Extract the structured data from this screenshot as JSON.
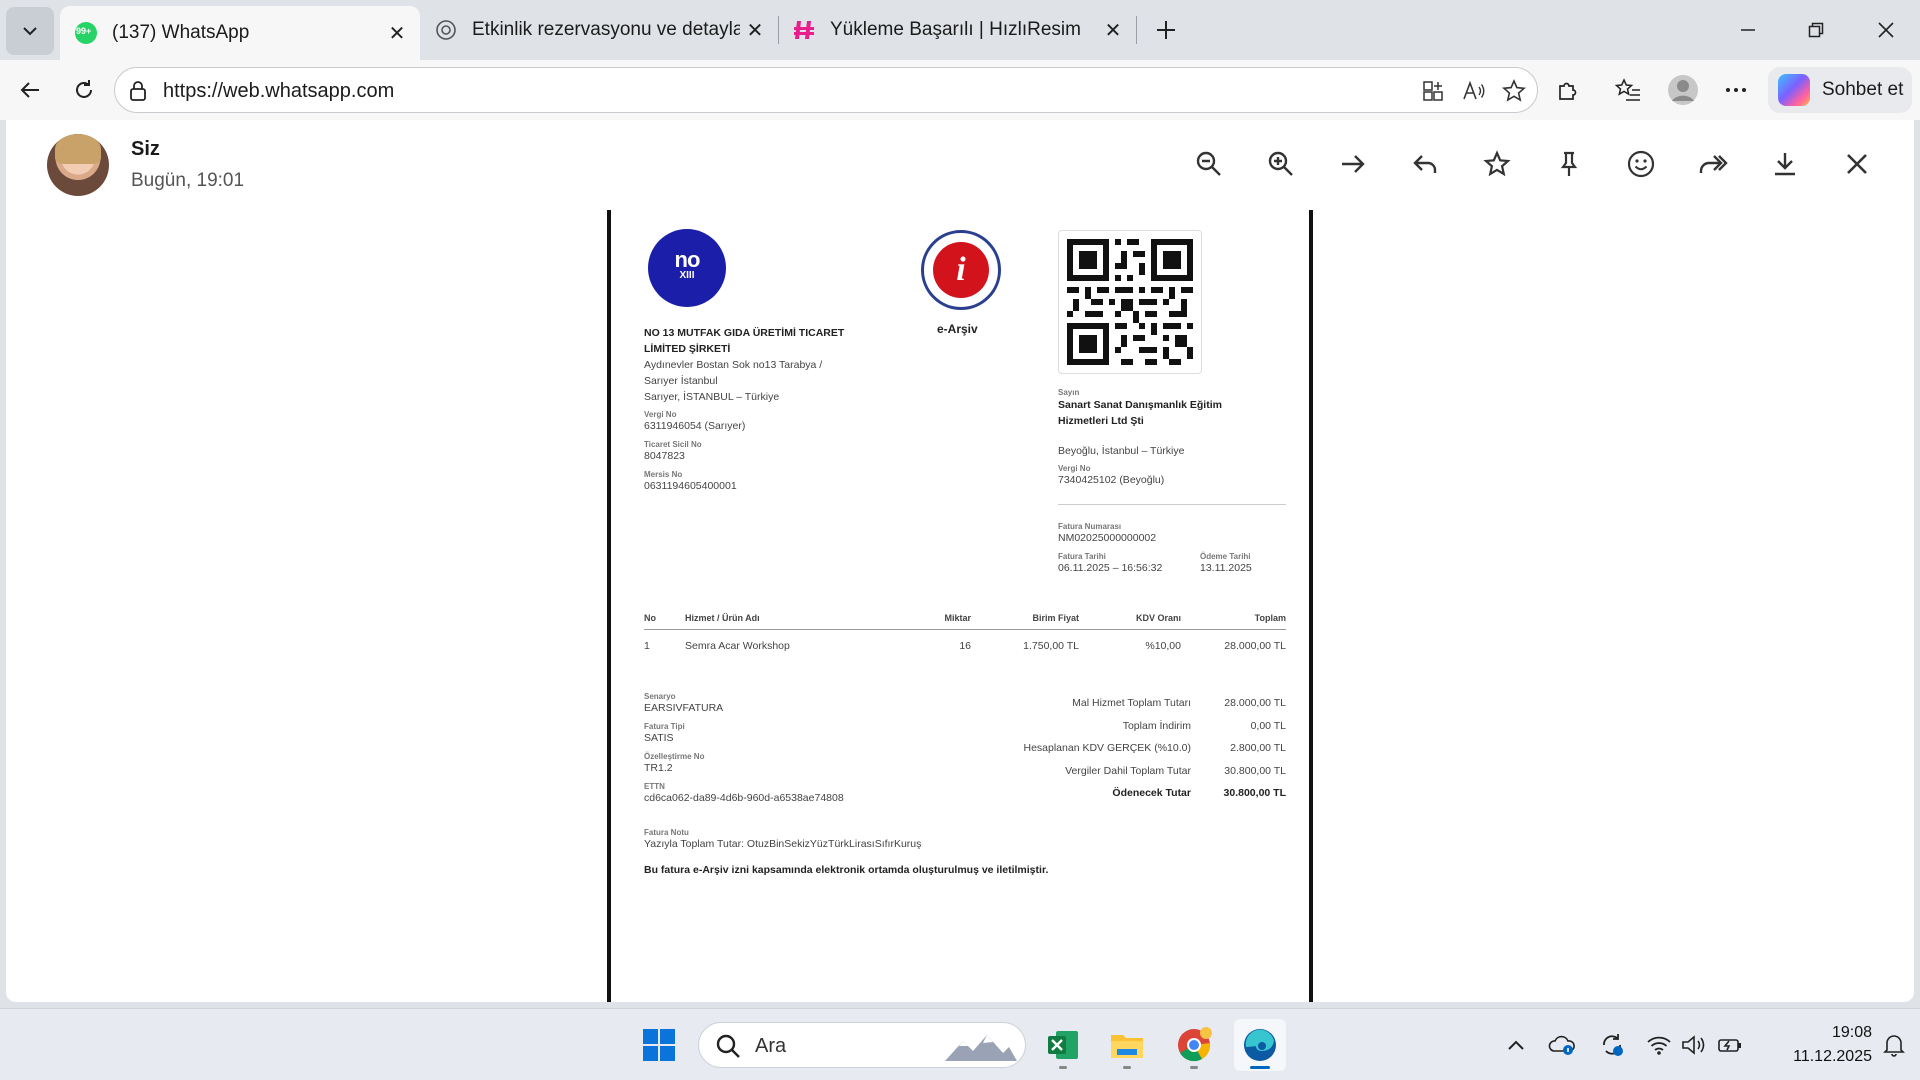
{
  "browser": {
    "tabs": [
      {
        "title": "(137) WhatsApp",
        "badge": "99+",
        "active": true
      },
      {
        "title": "Etkinlik rezervasyonu ve detaylar",
        "active": false
      },
      {
        "title": "Yükleme Başarılı | HızlıResim",
        "active": false
      }
    ],
    "url": "https://web.whatsapp.com",
    "copilot_label": "Sohbet et"
  },
  "viewer": {
    "sender": "Siz",
    "time": "Bugün, 19:01"
  },
  "invoice": {
    "logo_text": "no",
    "logo_sub": "XIII",
    "earsiv_label": "e-Arşiv",
    "seller": {
      "name_line1": "NO 13 MUTFAK GIDA ÜRETİMİ TICARET",
      "name_line2": "LİMİTED ŞİRKETİ",
      "addr1": "Aydınevler Bostan Sok no13 Tarabya /",
      "addr2": "Sarıyer İstanbul",
      "addr3": "Sarıyer, İSTANBUL – Türkiye",
      "vergi_label": "Vergi No",
      "vergi": "6311946054 (Sarıyer)",
      "sicil_label": "Ticaret Sicil No",
      "sicil": "8047823",
      "mersis_label": "Mersis No",
      "mersis": "0631194605400001"
    },
    "buyer": {
      "sayin_label": "Sayın",
      "name_line1": "Sanart Sanat Danışmanlık Eğitim",
      "name_line2": "Hizmetleri Ltd Şti",
      "addr": "Beyoğlu, İstanbul – Türkiye",
      "vergi_label": "Vergi No",
      "vergi": "7340425102 (Beyoğlu)"
    },
    "meta": {
      "no_label": "Fatura Numarası",
      "no": "NM02025000000002",
      "date_label": "Fatura Tarihi",
      "date": "06.11.2025 – 16:56:32",
      "due_label": "Ödeme Tarihi",
      "due": "13.11.2025"
    },
    "table": {
      "headers": [
        "No",
        "Hizmet / Ürün Adı",
        "Miktar",
        "Birim Fiyat",
        "KDV Oranı",
        "Toplam"
      ],
      "rows": [
        [
          "1",
          "Semra Acar Workshop",
          "16",
          "1.750,00 TL",
          "%10,00",
          "28.000,00 TL"
        ]
      ]
    },
    "details": {
      "senaryo_label": "Senaryo",
      "senaryo": "EARSIVFATURA",
      "tip_label": "Fatura Tipi",
      "tip": "SATIS",
      "ozel_label": "Özelleştirme No",
      "ozel": "TR1.2",
      "ettn_label": "ETTN",
      "ettn": "cd6ca062-da89-4d6b-960d-a6538ae74808"
    },
    "totals": [
      {
        "label": "Mal Hizmet Toplam Tutarı",
        "value": "28.000,00 TL"
      },
      {
        "label": "Toplam İndirim",
        "value": "0,00 TL"
      },
      {
        "label": "Hesaplanan KDV GERÇEK (%10.0)",
        "value": "2.800,00 TL"
      },
      {
        "label": "Vergiler Dahil Toplam Tutar",
        "value": "30.800,00 TL"
      },
      {
        "label": "Ödenecek Tutar",
        "value": "30.800,00 TL"
      }
    ],
    "note_label": "Fatura Notu",
    "note": "Yazıyla Toplam Tutar: OtuzBinSekizYüzTürkLirasıSıfırKuruş",
    "footer": "Bu fatura e-Arşiv izni kapsamında elektronik ortamda oluşturulmuş ve iletilmiştir."
  },
  "taskbar": {
    "search_placeholder": "Ara",
    "time": "19:08",
    "date": "11.12.2025"
  },
  "colors": {
    "whatsapp_green": "#25d366",
    "edge_blue": "#0067c0",
    "logo_blue": "#1a1ea8",
    "seal_red": "#d3131b"
  }
}
